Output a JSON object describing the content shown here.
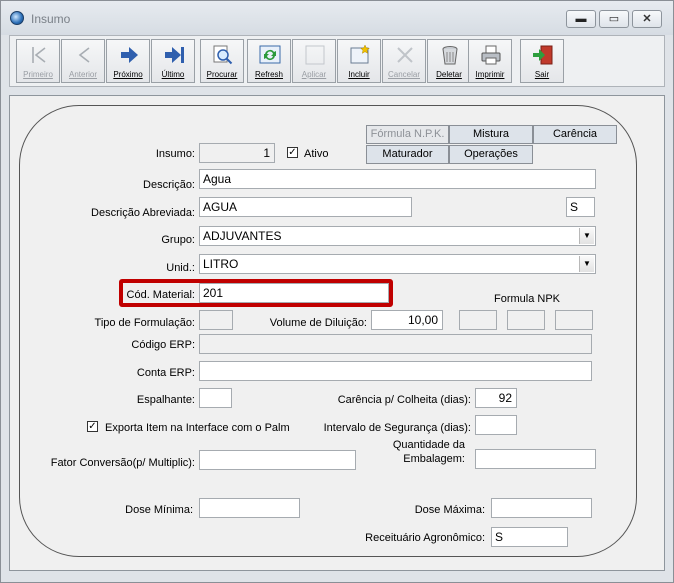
{
  "window": {
    "title": "Insumo"
  },
  "window_controls": {
    "minimize": "▬",
    "maximize": "▭",
    "close": "✕"
  },
  "toolbar": [
    {
      "label": "Primeiro",
      "icon": "first-record-icon",
      "enabled": false
    },
    {
      "label": "Anterior",
      "icon": "previous-record-icon",
      "enabled": false
    },
    {
      "label": "Próximo",
      "icon": "next-record-icon",
      "enabled": true
    },
    {
      "label": "Último",
      "icon": "last-record-icon",
      "enabled": true
    },
    {
      "label": "Procurar",
      "icon": "search-icon",
      "enabled": true
    },
    {
      "label": "Refresh",
      "icon": "refresh-icon",
      "enabled": true
    },
    {
      "label": "Aplicar",
      "icon": "apply-icon",
      "enabled": false
    },
    {
      "label": "Incluir",
      "icon": "new-record-icon",
      "enabled": true
    },
    {
      "label": "Cancelar",
      "icon": "cancel-icon",
      "enabled": false
    },
    {
      "label": "Deletar",
      "icon": "trash-icon",
      "enabled": true
    },
    {
      "label": "Imprimir",
      "icon": "printer-icon",
      "enabled": true
    },
    {
      "label": "Sair",
      "icon": "exit-door-icon",
      "enabled": true
    }
  ],
  "tabs": {
    "formula_npk": "Fórmula N.P.K.",
    "mistura": "Mistura",
    "carencia": "Carência",
    "maturador": "Maturador",
    "operacoes": "Operações"
  },
  "form": {
    "insumo_label": "Insumo:",
    "insumo_value": "1",
    "ativo_label": "Ativo",
    "ativo_checked": "✓",
    "descricao_label": "Descrição:",
    "descricao_value": "Agua",
    "descricao_abrev_label": "Descrição Abreviada:",
    "descricao_abrev_value": "AGUA",
    "s_value": "S",
    "grupo_label": "Grupo:",
    "grupo_value": "ADJUVANTES",
    "unid_label": "Unid.:",
    "unid_value": "LITRO",
    "cod_material_label": "Cód. Material:",
    "cod_material_value": "201",
    "formula_npk_label": "Formula NPK",
    "tipo_formulacao_label": "Tipo de Formulação:",
    "volume_diluicao_label": "Volume de Diluição:",
    "volume_diluicao_value": "10,00",
    "codigo_erp_label": "Código ERP:",
    "conta_erp_label": "Conta ERP:",
    "espalhante_label": "Espalhante:",
    "carencia_colheita_label": "Carência p/ Colheita (dias):",
    "carencia_colheita_value": "92",
    "exporta_label": "Exporta Item na Interface com o Palm",
    "exporta_checked": "✓",
    "intervalo_seguranca_label": "Intervalo de Segurança (dias):",
    "quantidade_embalagem_label_1": "Quantidade da",
    "quantidade_embalagem_label_2": "Embalagem:",
    "fator_conversao_label": "Fator Conversão(p/ Multiplic):",
    "dose_minima_label": "Dose Mínima:",
    "dose_maxima_label": "Dose Máxima:",
    "receituario_label": "Receituário Agronômico:",
    "receituario_value": "S",
    "combo_arrow": "▼"
  },
  "colors": {
    "highlight": "#c00000"
  }
}
